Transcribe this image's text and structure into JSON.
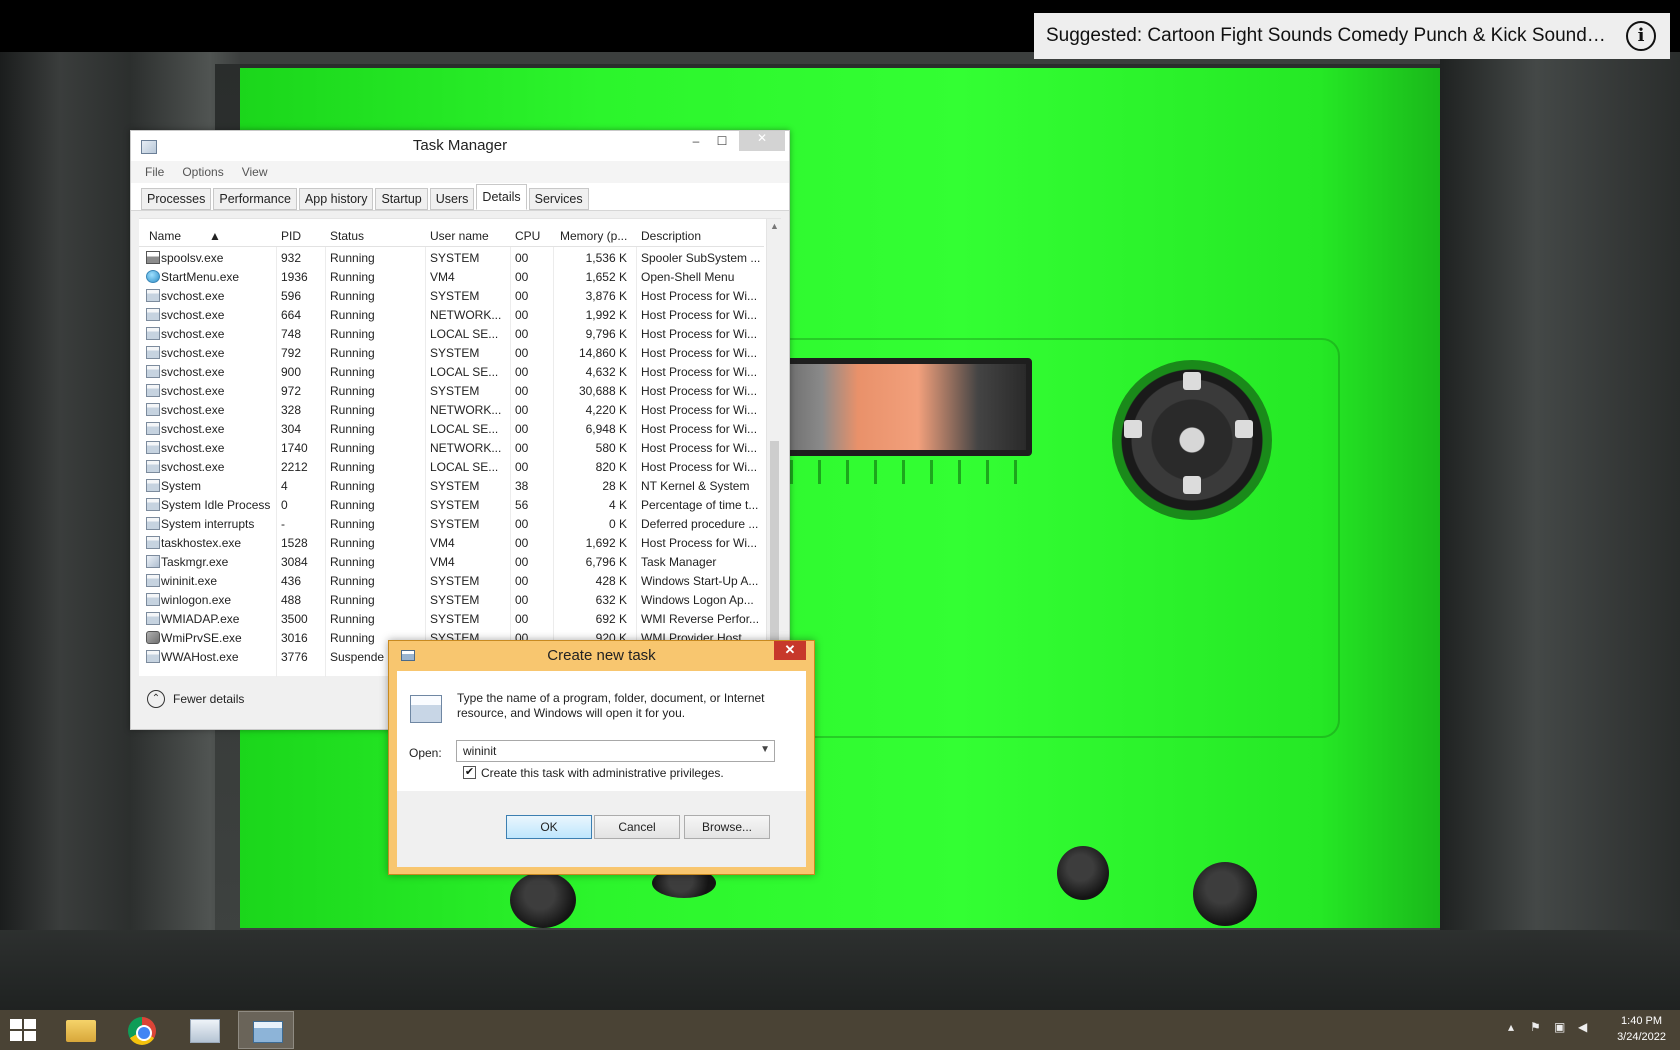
{
  "banner": {
    "text": "Suggested: Cartoon Fight Sounds Comedy Punch & Kick Sound Ef...",
    "info_glyph": "i"
  },
  "task_manager": {
    "title": "Task Manager",
    "menu": [
      "File",
      "Options",
      "View"
    ],
    "tabs": [
      "Processes",
      "Performance",
      "App history",
      "Startup",
      "Users",
      "Details",
      "Services"
    ],
    "active_tab": "Details",
    "columns": [
      "Name",
      "PID",
      "Status",
      "User name",
      "CPU",
      "Memory (p...",
      "Description"
    ],
    "rows": [
      {
        "name": "spoolsv.exe",
        "pid": "932",
        "status": "Running",
        "user": "SYSTEM",
        "cpu": "00",
        "mem": "1,536 K",
        "desc": "Spooler SubSystem ...",
        "icon": "printer-icon"
      },
      {
        "name": "StartMenu.exe",
        "pid": "1936",
        "status": "Running",
        "user": "VM4",
        "cpu": "00",
        "mem": "1,652 K",
        "desc": "Open-Shell Menu",
        "icon": "app-icon"
      },
      {
        "name": "svchost.exe",
        "pid": "596",
        "status": "Running",
        "user": "SYSTEM",
        "cpu": "00",
        "mem": "3,876 K",
        "desc": "Host Process for Wi...",
        "icon": "process-icon"
      },
      {
        "name": "svchost.exe",
        "pid": "664",
        "status": "Running",
        "user": "NETWORK...",
        "cpu": "00",
        "mem": "1,992 K",
        "desc": "Host Process for Wi...",
        "icon": "process-icon"
      },
      {
        "name": "svchost.exe",
        "pid": "748",
        "status": "Running",
        "user": "LOCAL SE...",
        "cpu": "00",
        "mem": "9,796 K",
        "desc": "Host Process for Wi...",
        "icon": "process-icon"
      },
      {
        "name": "svchost.exe",
        "pid": "792",
        "status": "Running",
        "user": "SYSTEM",
        "cpu": "00",
        "mem": "14,860 K",
        "desc": "Host Process for Wi...",
        "icon": "process-icon"
      },
      {
        "name": "svchost.exe",
        "pid": "900",
        "status": "Running",
        "user": "LOCAL SE...",
        "cpu": "00",
        "mem": "4,632 K",
        "desc": "Host Process for Wi...",
        "icon": "process-icon"
      },
      {
        "name": "svchost.exe",
        "pid": "972",
        "status": "Running",
        "user": "SYSTEM",
        "cpu": "00",
        "mem": "30,688 K",
        "desc": "Host Process for Wi...",
        "icon": "process-icon"
      },
      {
        "name": "svchost.exe",
        "pid": "328",
        "status": "Running",
        "user": "NETWORK...",
        "cpu": "00",
        "mem": "4,220 K",
        "desc": "Host Process for Wi...",
        "icon": "process-icon"
      },
      {
        "name": "svchost.exe",
        "pid": "304",
        "status": "Running",
        "user": "LOCAL SE...",
        "cpu": "00",
        "mem": "6,948 K",
        "desc": "Host Process for Wi...",
        "icon": "process-icon"
      },
      {
        "name": "svchost.exe",
        "pid": "1740",
        "status": "Running",
        "user": "NETWORK...",
        "cpu": "00",
        "mem": "580 K",
        "desc": "Host Process for Wi...",
        "icon": "process-icon"
      },
      {
        "name": "svchost.exe",
        "pid": "2212",
        "status": "Running",
        "user": "LOCAL SE...",
        "cpu": "00",
        "mem": "820 K",
        "desc": "Host Process for Wi...",
        "icon": "process-icon"
      },
      {
        "name": "System",
        "pid": "4",
        "status": "Running",
        "user": "SYSTEM",
        "cpu": "38",
        "mem": "28 K",
        "desc": "NT Kernel & System",
        "icon": "process-icon"
      },
      {
        "name": "System Idle Process",
        "pid": "0",
        "status": "Running",
        "user": "SYSTEM",
        "cpu": "56",
        "mem": "4 K",
        "desc": "Percentage of time t...",
        "icon": "process-icon"
      },
      {
        "name": "System interrupts",
        "pid": "-",
        "status": "Running",
        "user": "SYSTEM",
        "cpu": "00",
        "mem": "0 K",
        "desc": "Deferred procedure ...",
        "icon": "process-icon"
      },
      {
        "name": "taskhostex.exe",
        "pid": "1528",
        "status": "Running",
        "user": "VM4",
        "cpu": "00",
        "mem": "1,692 K",
        "desc": "Host Process for Wi...",
        "icon": "process-icon"
      },
      {
        "name": "Taskmgr.exe",
        "pid": "3084",
        "status": "Running",
        "user": "VM4",
        "cpu": "00",
        "mem": "6,796 K",
        "desc": "Task Manager",
        "icon": "task-manager-icon"
      },
      {
        "name": "wininit.exe",
        "pid": "436",
        "status": "Running",
        "user": "SYSTEM",
        "cpu": "00",
        "mem": "428 K",
        "desc": "Windows Start-Up A...",
        "icon": "process-icon"
      },
      {
        "name": "winlogon.exe",
        "pid": "488",
        "status": "Running",
        "user": "SYSTEM",
        "cpu": "00",
        "mem": "632 K",
        "desc": "Windows Logon Ap...",
        "icon": "process-icon"
      },
      {
        "name": "WMIADAP.exe",
        "pid": "3500",
        "status": "Running",
        "user": "SYSTEM",
        "cpu": "00",
        "mem": "692 K",
        "desc": "WMI Reverse Perfor...",
        "icon": "process-icon"
      },
      {
        "name": "WmiPrvSE.exe",
        "pid": "3016",
        "status": "Running",
        "user": "SYSTEM",
        "cpu": "00",
        "mem": "920 K",
        "desc": "WMI Provider Host",
        "icon": "gear-icon"
      },
      {
        "name": "WWAHost.exe",
        "pid": "3776",
        "status": "Suspende",
        "user": "",
        "cpu": "",
        "mem": "",
        "desc": "",
        "icon": "process-icon"
      }
    ],
    "footer_label": "Fewer details",
    "footer_glyph": "⌃"
  },
  "dialog": {
    "title": "Create new task",
    "close_glyph": "✕",
    "message": "Type the name of a program, folder, document, or Internet resource, and Windows will open it for you.",
    "open_label": "Open:",
    "open_value": "wininit",
    "admin_checkbox_label": "Create this task with administrative privileges.",
    "admin_checked": true,
    "buttons": {
      "ok": "OK",
      "cancel": "Cancel",
      "browse": "Browse..."
    }
  },
  "taskbar": {
    "clock_time": "1:40 PM",
    "clock_date": "3/24/2022",
    "tray_up_glyph": "▴"
  },
  "colors": {
    "cassette_green": "#2cf52c",
    "dialog_frame": "#f8c66f",
    "taskbar": "#4a4335",
    "close_red": "#c7382b"
  }
}
